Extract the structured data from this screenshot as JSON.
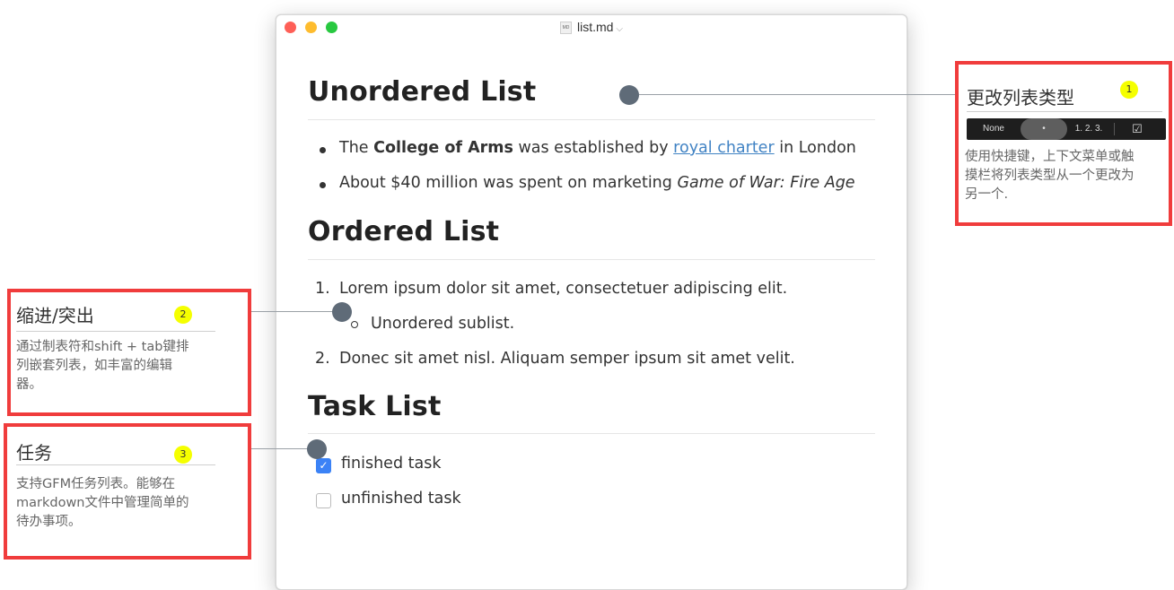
{
  "window": {
    "title": "list.md",
    "file_icon_text": "MD",
    "chevron": "⌵"
  },
  "unordered": {
    "heading": "Unordered List",
    "item1": {
      "pre": "The ",
      "bold": "College of Arms",
      "mid": " was established by ",
      "link": "royal charter",
      "post": " in London"
    },
    "item2": {
      "pre": "About $40 million was spent on marketing ",
      "italic": "Game of War: Fire Age"
    }
  },
  "ordered": {
    "heading": "Ordered List",
    "items": [
      {
        "num": "1.",
        "text": "Lorem ipsum dolor sit amet, consectetuer adipiscing elit."
      },
      {
        "num": "2.",
        "text": "Donec sit amet nisl. Aliquam semper ipsum sit amet velit."
      }
    ],
    "sublist_item": "Unordered sublist."
  },
  "tasks": {
    "heading": "Task List",
    "items": [
      {
        "text": "finished task",
        "checked": true
      },
      {
        "text": "unfinished task",
        "checked": false
      }
    ]
  },
  "annotations": [
    {
      "badge": "1",
      "title": "更改列表类型",
      "desc_lines": [
        "使用快捷键，上下文菜单或触",
        "摸栏将列表类型从一个更改为",
        "另一个."
      ]
    },
    {
      "badge": "2",
      "title": "缩进/突出",
      "desc_lines": [
        "通过制表符和shift + tab键排",
        "列嵌套列表，如丰富的编辑",
        "器。"
      ]
    },
    {
      "badge": "3",
      "title": "任务",
      "desc_lines": [
        "支持GFM任务列表。能够在",
        "markdown文件中管理简单的",
        "待办事项。"
      ]
    }
  ],
  "touchbar": {
    "options": [
      "None",
      "•",
      "1. 2. 3.",
      "☑"
    ],
    "selected": "•"
  },
  "colors": {
    "annotation_border": "#f03c3c",
    "badge": "#f5ff00",
    "link": "#4183c4",
    "checkbox_checked": "#3b82f6",
    "connector_dot": "#5f6b78"
  }
}
